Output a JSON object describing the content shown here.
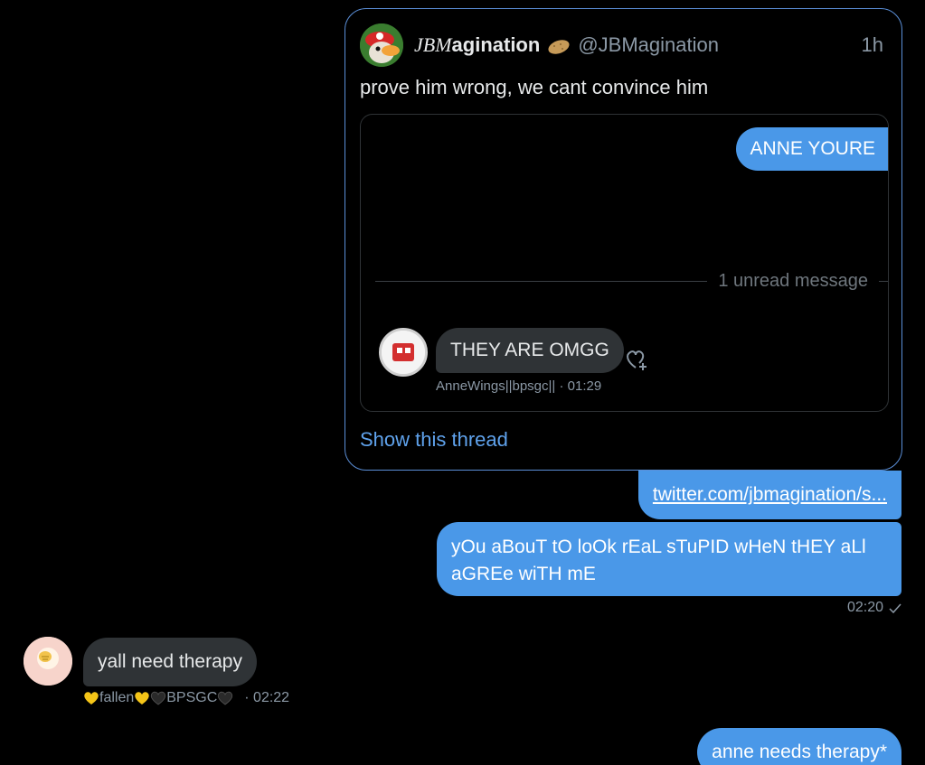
{
  "quoted_tweet": {
    "author_name_prefix": "JBM",
    "author_name_suffix": "agination",
    "handle": "@JBMagination",
    "time": "1h",
    "text": "prove him wrong, we cant convince him",
    "embedded_screenshot": {
      "sent_bubble": "ANNE YOURE",
      "unread_divider": "1 unread message",
      "received_bubble": "THEY ARE OMGG",
      "received_meta": "AnneWings||bpsgc|| · 01:29"
    },
    "show_thread_label": "Show this thread"
  },
  "messages": {
    "link": "twitter.com/jbmagination/s...",
    "sent_text": "yOu aBouT tO loOk rEaL sTuPID wHeN tHEY aLl aGREe wiTH mE",
    "sent_time": "02:20",
    "received_text": "yall need therapy",
    "received_sender_a": "fallen",
    "received_sender_b": "BPSGC",
    "received_time": "· 02:22",
    "final_text": "anne needs therapy*"
  },
  "colors": {
    "background": "#000000",
    "sent_bubble": "#4a98e8",
    "received_bubble": "#2f3336",
    "card_border": "#5b8fd8",
    "link_accent": "#5fa2ec",
    "muted_text": "#8b98a5"
  },
  "icons": {
    "potato": "potato-emoji",
    "react": "add-reaction-icon",
    "read_check": "checkmark-icon",
    "heart_gold": "yellow-heart-emoji",
    "heart_black": "black-heart-emoji"
  }
}
